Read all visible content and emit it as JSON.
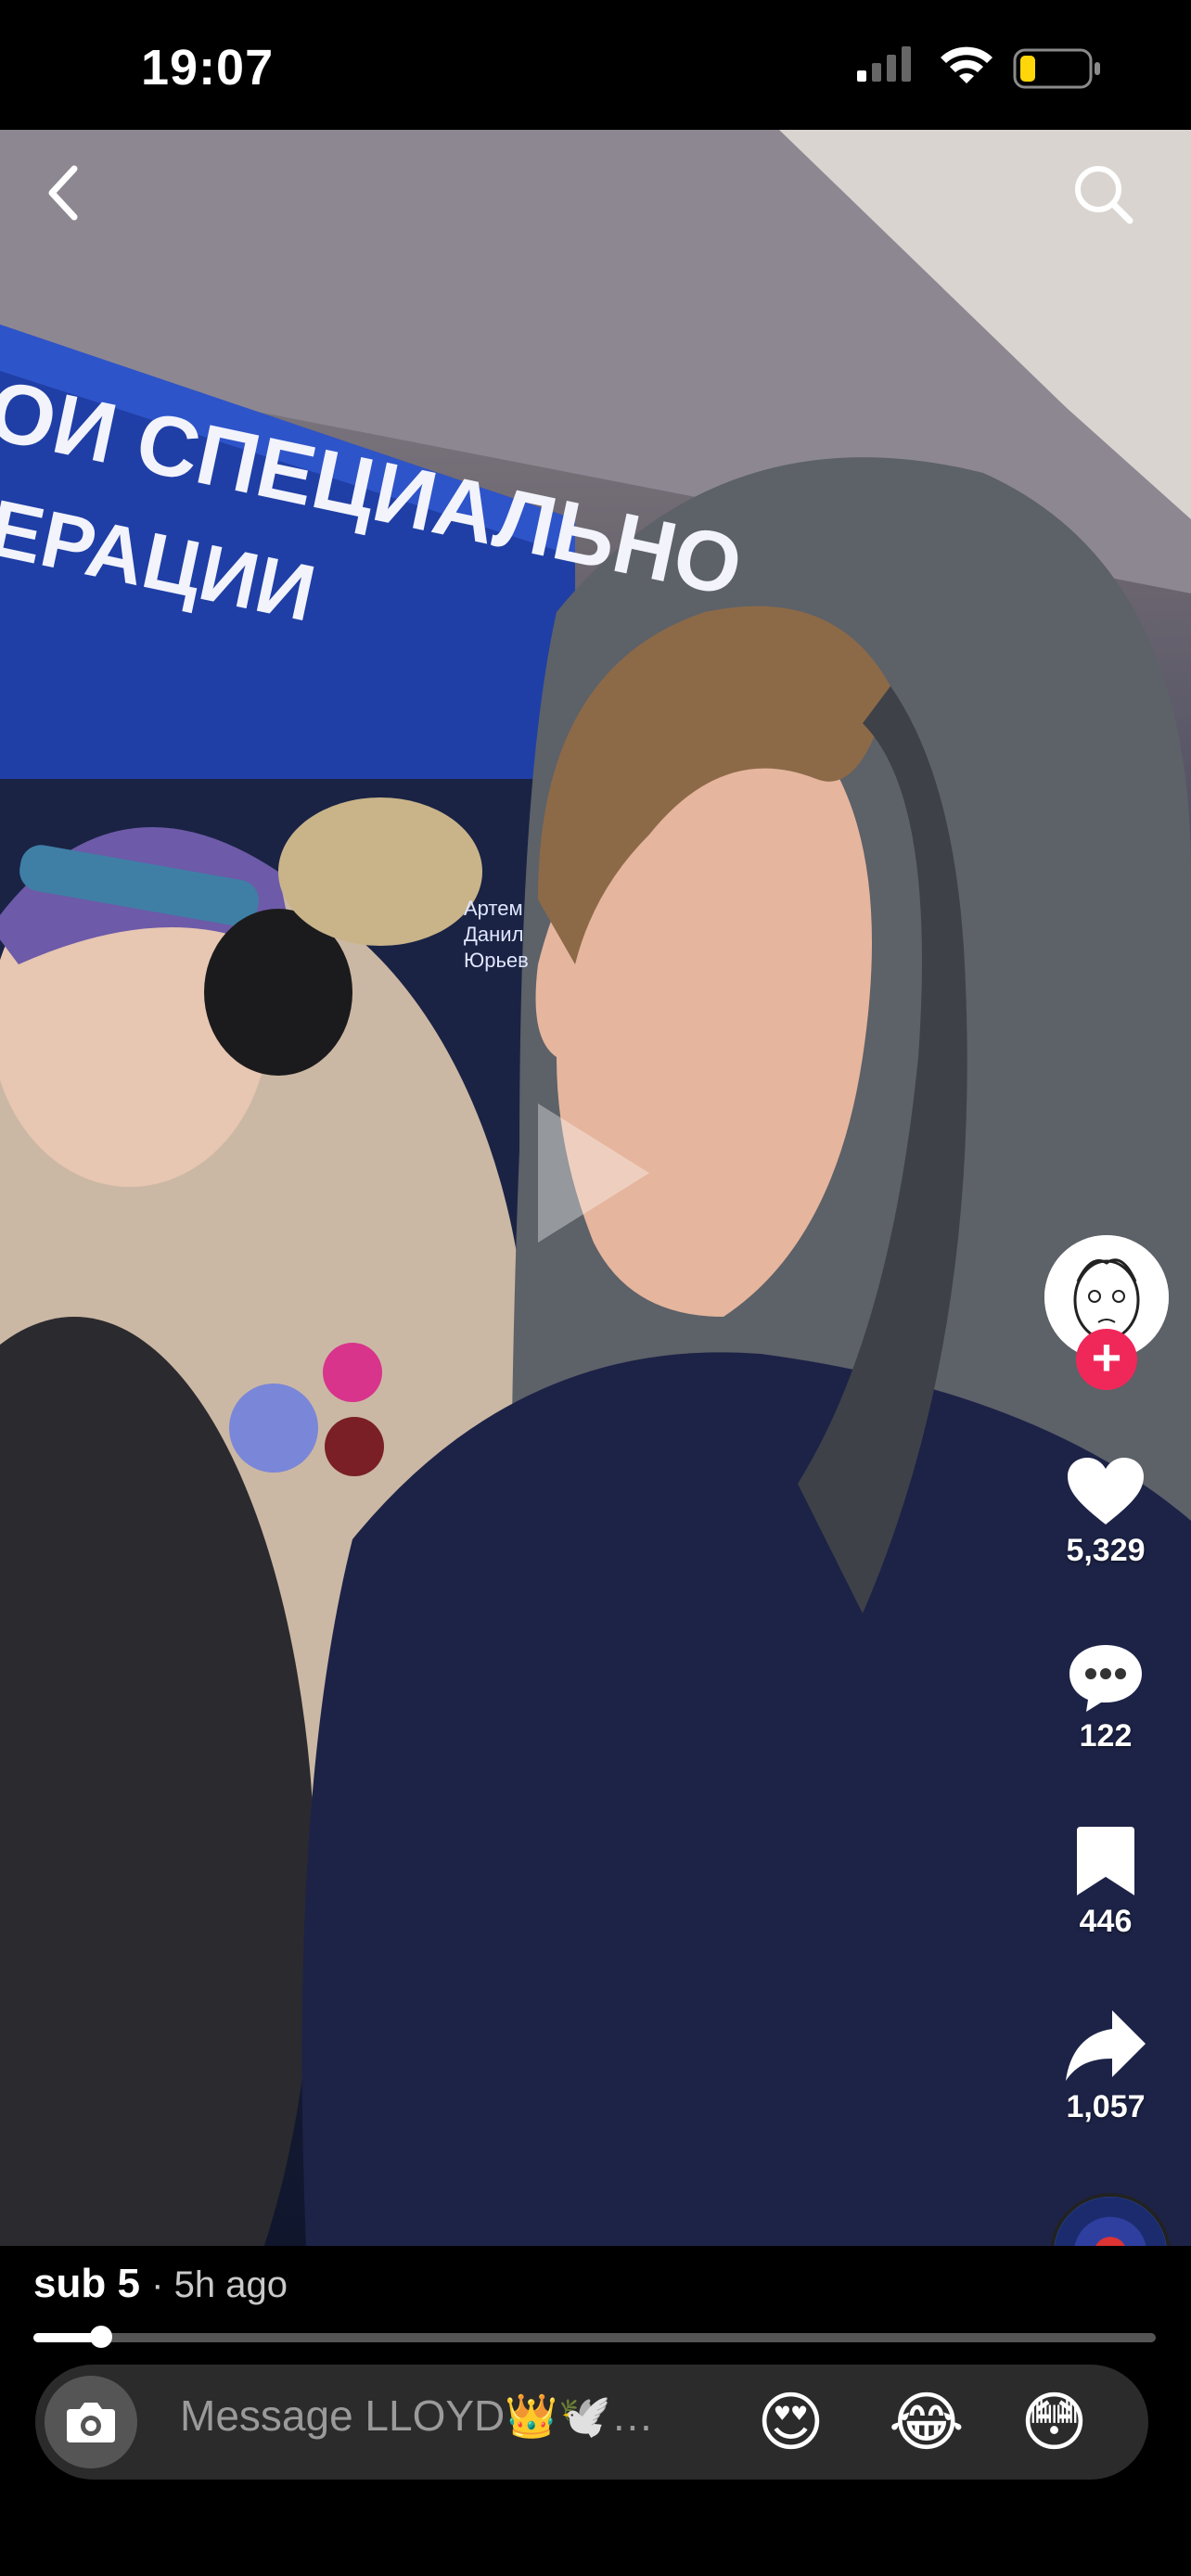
{
  "status": {
    "time": "19:07"
  },
  "video": {
    "sign_line1": "ОИ СПЕЦИАЛЬНО",
    "sign_line2": "ЕРАЦИИ",
    "sign_names": [
      "Артем",
      "Данил",
      "Юрьев"
    ]
  },
  "actions": {
    "likes": "5,329",
    "comments": "122",
    "bookmarks": "446",
    "shares": "1,057"
  },
  "caption": {
    "name": "sub 5",
    "time": "· 5h ago"
  },
  "progress": {
    "value": 0.06
  },
  "message": {
    "placeholder": "Message LLOYD👑🕊️…",
    "emojis": [
      "😍",
      "😂",
      "😳"
    ]
  },
  "icons": {
    "back": "chevron-left-icon",
    "search": "search-icon",
    "play": "play-icon",
    "heart": "heart-icon",
    "comment": "comment-icon",
    "bookmark": "bookmark-icon",
    "share": "share-icon",
    "camera": "camera-icon"
  },
  "colors": {
    "follow": "#f0285a",
    "background": "#000000"
  }
}
